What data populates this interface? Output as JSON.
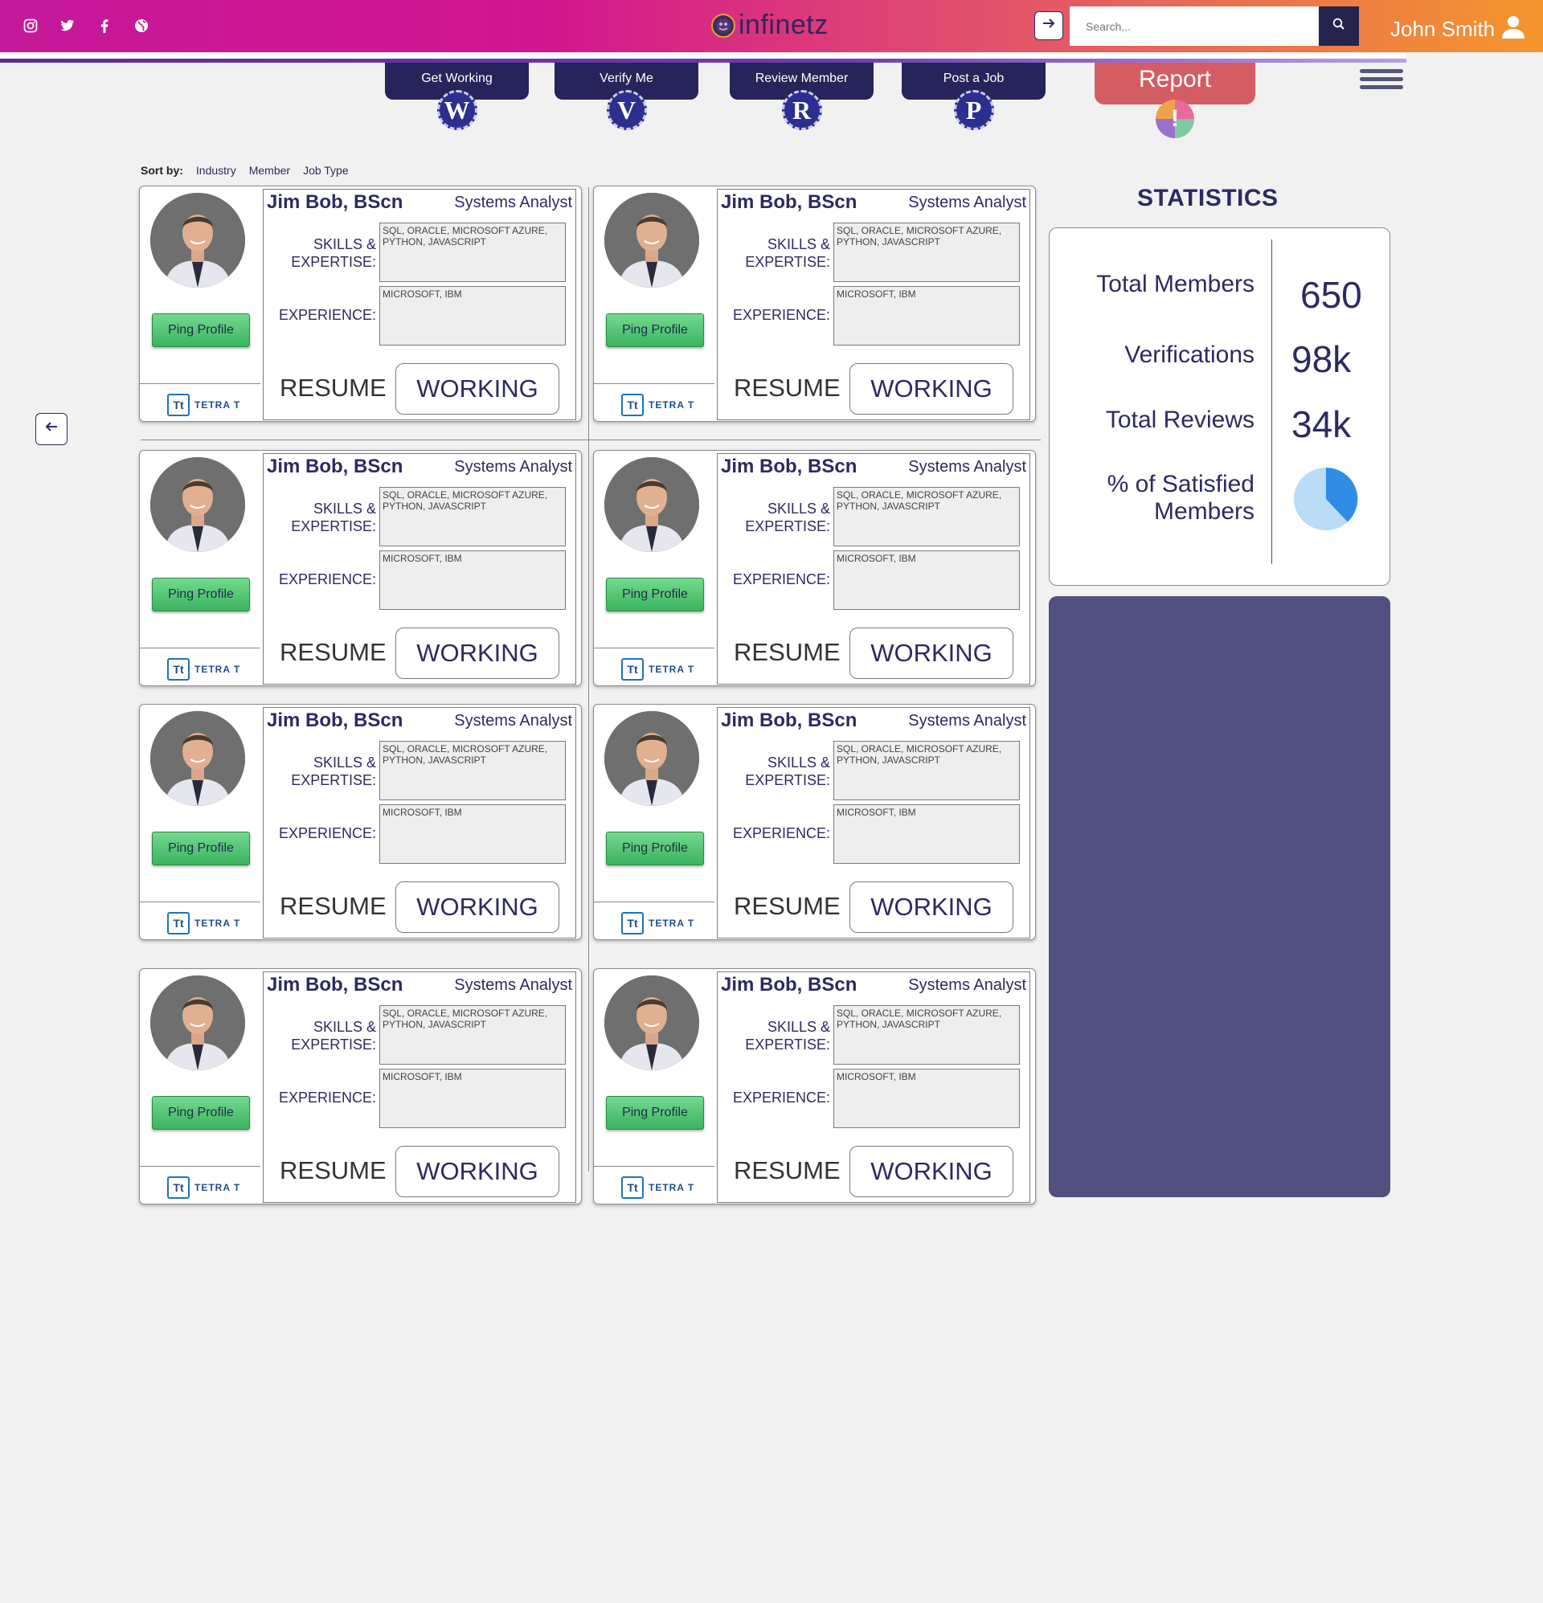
{
  "header": {
    "social_icons": [
      "instagram-icon",
      "twitter-icon",
      "facebook-icon",
      "globe-icon"
    ],
    "logo_text": "infinetz",
    "search_placeholder": "Search...",
    "user_name": "John Smith",
    "colors": {
      "gradient_start": "#c4199a",
      "gradient_end": "#f4962d",
      "navy": "#26245a"
    }
  },
  "nav": {
    "tabs": [
      {
        "label": "Get Working",
        "badge": "W"
      },
      {
        "label": "Verify Me",
        "badge": "V"
      },
      {
        "label": "Review Member",
        "badge": "R"
      },
      {
        "label": "Post a Job",
        "badge": "P"
      }
    ],
    "report": {
      "label": "Report",
      "badge": "!"
    }
  },
  "sort": {
    "label": "Sort by:",
    "options": [
      "Industry",
      "Member",
      "Job Type"
    ]
  },
  "card_template": {
    "name": "Jim Bob, BScn",
    "role": "Systems Analyst",
    "skills_label_1": "SKILLS &",
    "skills_label_2": "EXPERTISE:",
    "skills_value": "SQL, ORACLE, MICROSOFT AZURE, PYTHON, JAVASCRIPT",
    "experience_label": "EXPERIENCE:",
    "experience_value": "MICROSOFT, IBM",
    "ping_label": "Ping Profile",
    "company": "TETRA T",
    "company_mark": "Tt",
    "resume_label": "RESUME",
    "working_label": "WORKING"
  },
  "cards_count": 8,
  "stats": {
    "title": "STATISTICS",
    "total_members_label": "Total Members",
    "total_members_value": "650",
    "verifications_label": "Verifications",
    "verifications_value": "98k",
    "total_reviews_label": "Total Reviews",
    "total_reviews_value": "34k",
    "satisfied_label_1": "% of Satisfied",
    "satisfied_label_2": "Members",
    "satisfied_fraction": 0.38,
    "pie_colors": {
      "filled": "#2f8de4",
      "remaining": "#b9dcf7"
    }
  }
}
